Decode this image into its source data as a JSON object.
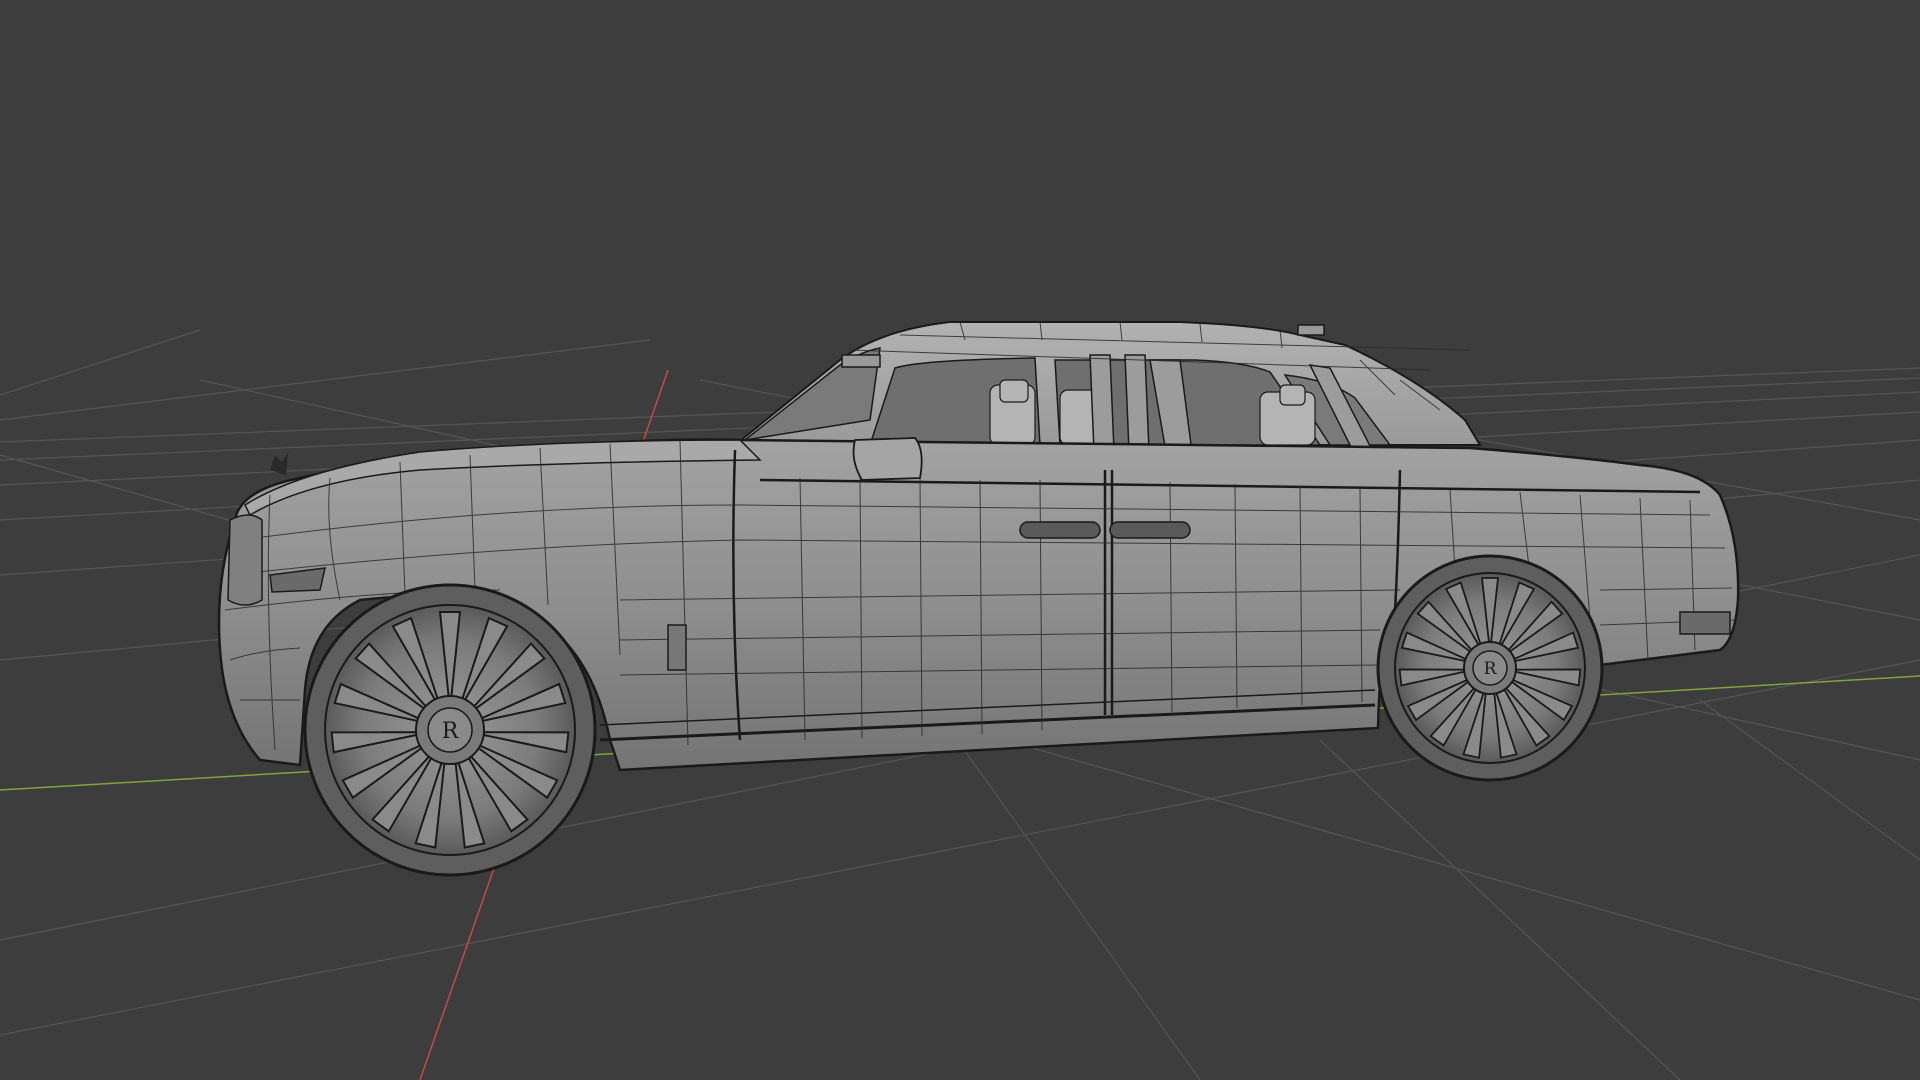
{
  "viewport": {
    "background": "#3d3d3d",
    "view_mode": "wireframe",
    "grid_visible": true,
    "grid_color": "#5a5a5a",
    "x_axis_color": "#c8474f",
    "y_axis_color": "#7fa63a"
  },
  "model": {
    "object_type": "car",
    "shading": "solid-with-wireframe",
    "body_color": "#8d8d8d",
    "wire_color": "#1a1a1a",
    "emblem_text": "R"
  }
}
